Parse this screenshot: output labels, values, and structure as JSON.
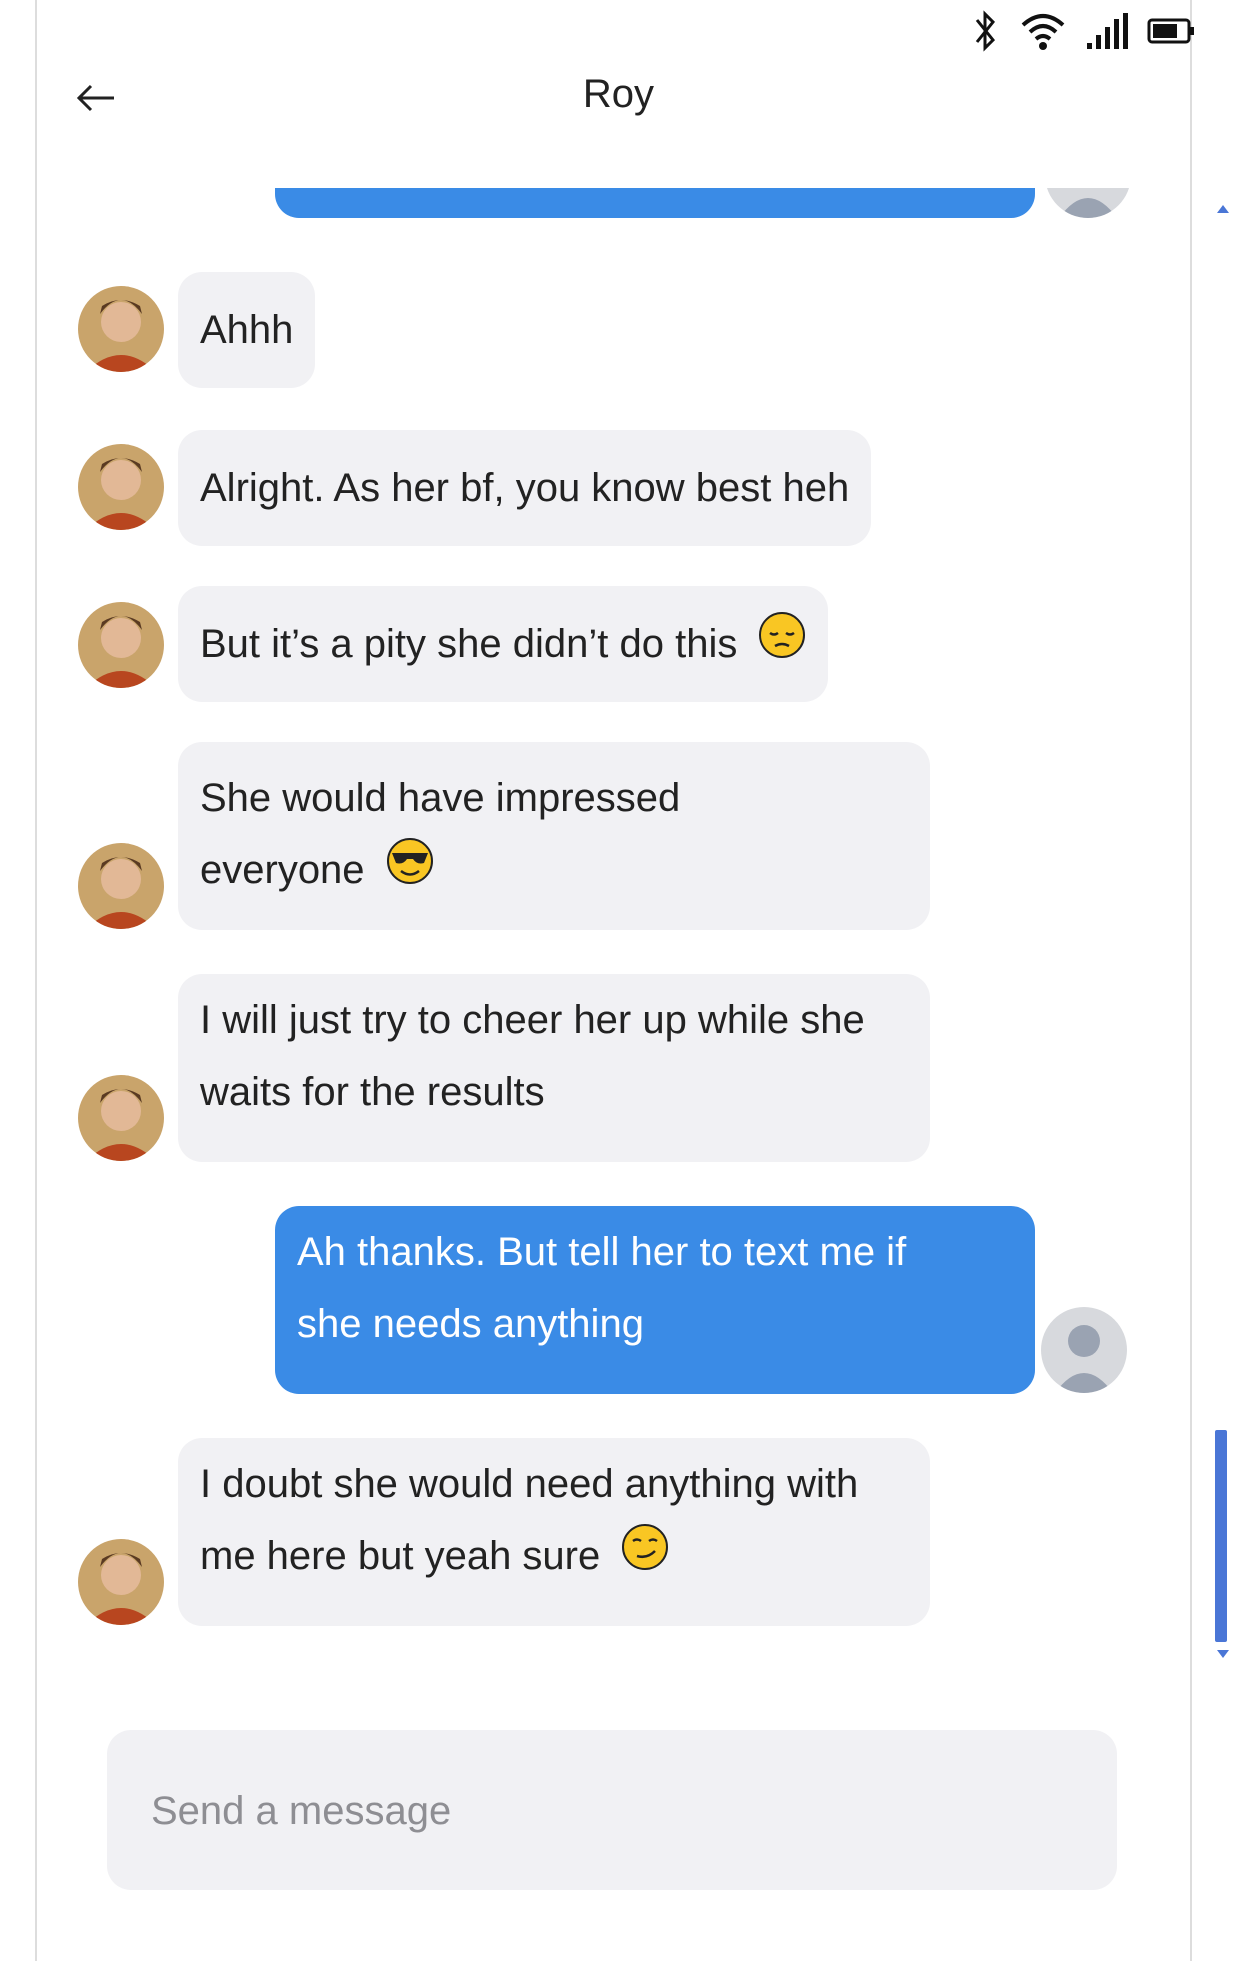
{
  "header": {
    "title": "Roy"
  },
  "status_bar": {
    "icons": [
      "bluetooth-icon",
      "wifi-icon",
      "signal-icon",
      "battery-icon"
    ]
  },
  "messages": [
    {
      "direction": "out",
      "text": ""
    },
    {
      "direction": "in",
      "lines": [
        "Ahhh"
      ]
    },
    {
      "direction": "in",
      "lines": [
        "Alright. As her bf, you know best heh"
      ]
    },
    {
      "direction": "in",
      "lines": [
        "But it’s a pity she didn’t do this"
      ],
      "emoji": "pensive-face"
    },
    {
      "direction": "in",
      "lines": [
        "She would have impressed",
        "everyone"
      ],
      "emoji": "sunglasses-face"
    },
    {
      "direction": "in",
      "lines": [
        "I will just try to cheer her up while she",
        "waits for the results"
      ]
    },
    {
      "direction": "out",
      "lines": [
        "Ah thanks. But tell her to text me if",
        "she needs anything"
      ]
    },
    {
      "direction": "in",
      "lines": [
        "I doubt she would need anything with",
        "me here but yeah sure"
      ],
      "emoji": "smirking-face"
    }
  ],
  "composer": {
    "placeholder": "Send a message"
  },
  "colors": {
    "outgoing_bubble": "#3a8be6",
    "incoming_bubble": "#f1f1f4",
    "scrollbar": "#4a76d6"
  }
}
